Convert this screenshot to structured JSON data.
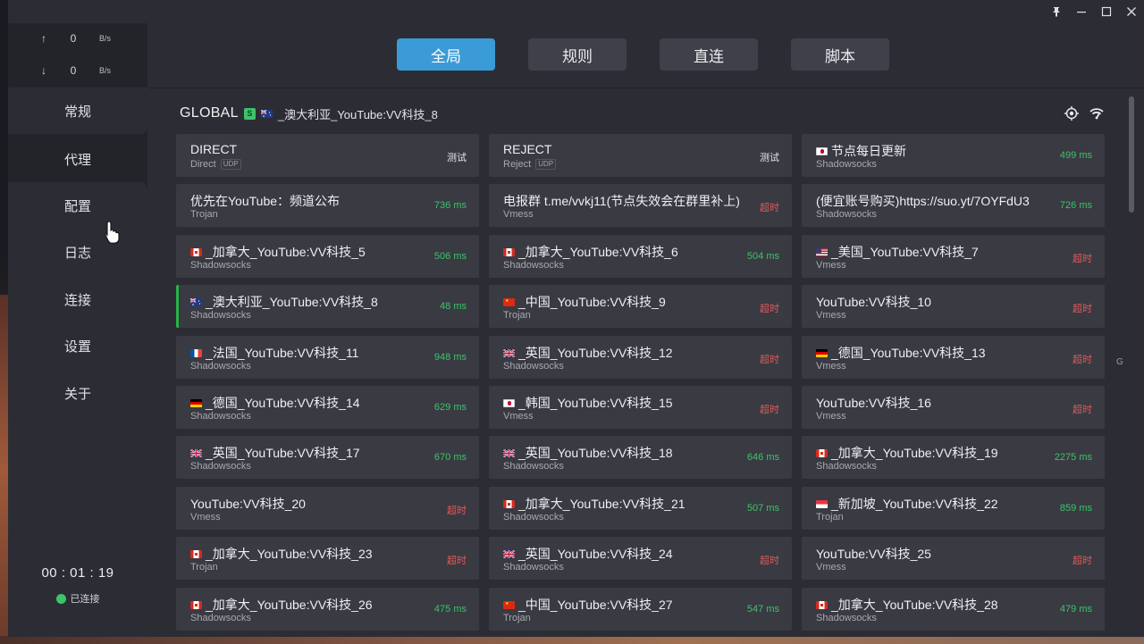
{
  "window": {
    "controls": [
      {
        "name": "pin-icon",
        "glyph": "📌"
      },
      {
        "name": "minimize-icon",
        "glyph": "—"
      },
      {
        "name": "maximize-icon",
        "glyph": "☐"
      },
      {
        "name": "close-icon",
        "glyph": "✕"
      }
    ]
  },
  "sidebar": {
    "traffic": {
      "up": {
        "arrow": "↑",
        "value": "0",
        "unit": "B/s"
      },
      "down": {
        "arrow": "↓",
        "value": "0",
        "unit": "B/s"
      }
    },
    "items": [
      {
        "label": "常规"
      },
      {
        "label": "代理"
      },
      {
        "label": "配置"
      },
      {
        "label": "日志"
      },
      {
        "label": "连接"
      },
      {
        "label": "设置"
      },
      {
        "label": "关于"
      }
    ],
    "active_index": 1,
    "timer": "00 : 01 : 19",
    "status": "已连接"
  },
  "modes": {
    "items": [
      {
        "label": "全局"
      },
      {
        "label": "规则"
      },
      {
        "label": "直连"
      },
      {
        "label": "脚本"
      }
    ],
    "active_index": 0
  },
  "group": {
    "name": "GLOBAL",
    "type_badge": "S",
    "current_flag": "AU",
    "current": "_澳大利亚_YouTube:VV科技_8"
  },
  "side_letter": "G",
  "colors": {
    "accent": "#3a9bd6",
    "ok": "#3cc46a",
    "timeout": "#e05a5a"
  },
  "proxies": [
    {
      "name": "DIRECT",
      "type": "Direct",
      "udp": "UDP",
      "delay": "测试",
      "delay_kind": "test"
    },
    {
      "name": "REJECT",
      "type": "Reject",
      "udp": "UDP",
      "delay": "测试",
      "delay_kind": "test"
    },
    {
      "flag": "JP",
      "name": "节点每日更新",
      "type": "Shadowsocks",
      "delay": "499 ms",
      "delay_kind": "ok"
    },
    {
      "name": "优先在YouTube：频道公布",
      "type": "Trojan",
      "delay": "736 ms",
      "delay_kind": "ok"
    },
    {
      "name": "电报群 t.me/vvkj11(节点失效会在群里补上)",
      "type": "Vmess",
      "delay": "超时",
      "delay_kind": "timeout"
    },
    {
      "name": "(便宜账号购买)https://suo.yt/7OYFdU3",
      "type": "Shadowsocks",
      "delay": "726 ms",
      "delay_kind": "ok"
    },
    {
      "flag": "CA",
      "name": "_加拿大_YouTube:VV科技_5",
      "type": "Shadowsocks",
      "delay": "506 ms",
      "delay_kind": "ok"
    },
    {
      "flag": "CA",
      "name": "_加拿大_YouTube:VV科技_6",
      "type": "Shadowsocks",
      "delay": "504 ms",
      "delay_kind": "ok"
    },
    {
      "flag": "US",
      "name": "_美国_YouTube:VV科技_7",
      "type": "Vmess",
      "delay": "超时",
      "delay_kind": "timeout"
    },
    {
      "flag": "AU",
      "name": "_澳大利亚_YouTube:VV科技_8",
      "type": "Shadowsocks",
      "delay": "48 ms",
      "delay_kind": "ok",
      "selected": true
    },
    {
      "flag": "CN",
      "name": "_中国_YouTube:VV科技_9",
      "type": "Trojan",
      "delay": "超时",
      "delay_kind": "timeout"
    },
    {
      "name": "YouTube:VV科技_10",
      "type": "Vmess",
      "delay": "超时",
      "delay_kind": "timeout"
    },
    {
      "flag": "FR",
      "name": "_法国_YouTube:VV科技_11",
      "type": "Shadowsocks",
      "delay": "948 ms",
      "delay_kind": "ok"
    },
    {
      "flag": "GB",
      "name": "_英国_YouTube:VV科技_12",
      "type": "Shadowsocks",
      "delay": "超时",
      "delay_kind": "timeout"
    },
    {
      "flag": "DE",
      "name": "_德国_YouTube:VV科技_13",
      "type": "Vmess",
      "delay": "超时",
      "delay_kind": "timeout"
    },
    {
      "flag": "DE",
      "name": "_德国_YouTube:VV科技_14",
      "type": "Shadowsocks",
      "delay": "629 ms",
      "delay_kind": "ok"
    },
    {
      "flag": "KR",
      "name": "_韩国_YouTube:VV科技_15",
      "type": "Vmess",
      "delay": "超时",
      "delay_kind": "timeout"
    },
    {
      "name": "YouTube:VV科技_16",
      "type": "Vmess",
      "delay": "超时",
      "delay_kind": "timeout"
    },
    {
      "flag": "GB",
      "name": "_英国_YouTube:VV科技_17",
      "type": "Shadowsocks",
      "delay": "670 ms",
      "delay_kind": "ok"
    },
    {
      "flag": "GB",
      "name": "_英国_YouTube:VV科技_18",
      "type": "Shadowsocks",
      "delay": "646 ms",
      "delay_kind": "ok"
    },
    {
      "flag": "CA",
      "name": "_加拿大_YouTube:VV科技_19",
      "type": "Shadowsocks",
      "delay": "2275 ms",
      "delay_kind": "ok"
    },
    {
      "name": "YouTube:VV科技_20",
      "type": "Vmess",
      "delay": "超时",
      "delay_kind": "timeout"
    },
    {
      "flag": "CA",
      "name": "_加拿大_YouTube:VV科技_21",
      "type": "Shadowsocks",
      "delay": "507 ms",
      "delay_kind": "ok"
    },
    {
      "flag": "SG",
      "name": "_新加坡_YouTube:VV科技_22",
      "type": "Trojan",
      "delay": "859 ms",
      "delay_kind": "ok"
    },
    {
      "flag": "CA",
      "name": "_加拿大_YouTube:VV科技_23",
      "type": "Trojan",
      "delay": "超时",
      "delay_kind": "timeout"
    },
    {
      "flag": "GB",
      "name": "_英国_YouTube:VV科技_24",
      "type": "Shadowsocks",
      "delay": "超时",
      "delay_kind": "timeout"
    },
    {
      "name": "YouTube:VV科技_25",
      "type": "Vmess",
      "delay": "超时",
      "delay_kind": "timeout"
    },
    {
      "flag": "CA",
      "name": "_加拿大_YouTube:VV科技_26",
      "type": "Shadowsocks",
      "delay": "475 ms",
      "delay_kind": "ok"
    },
    {
      "flag": "CN",
      "name": "_中国_YouTube:VV科技_27",
      "type": "Trojan",
      "delay": "547 ms",
      "delay_kind": "ok"
    },
    {
      "flag": "CA",
      "name": "_加拿大_YouTube:VV科技_28",
      "type": "Shadowsocks",
      "delay": "479 ms",
      "delay_kind": "ok"
    }
  ]
}
